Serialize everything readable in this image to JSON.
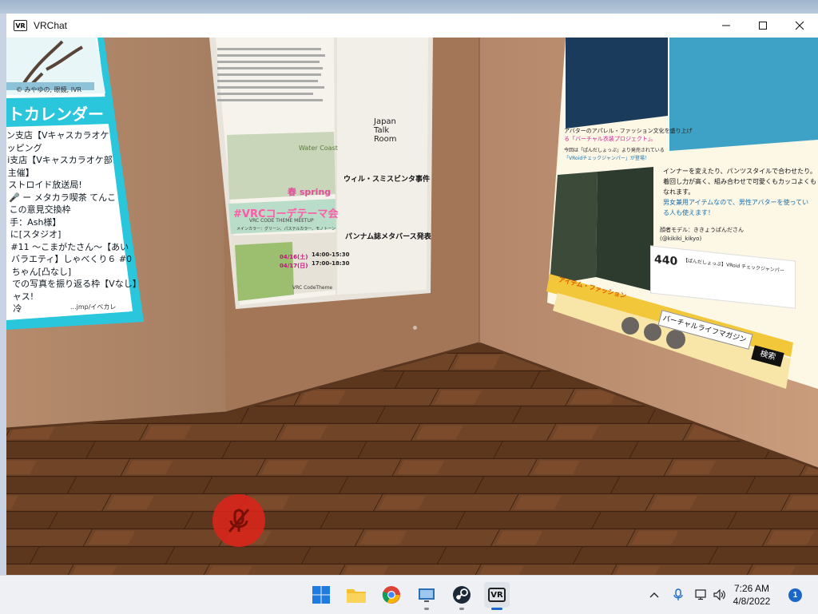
{
  "window": {
    "title": "VRChat",
    "icon_label": "VR",
    "controls": {
      "minimize": "—",
      "maximize": "☐",
      "close": "✕"
    }
  },
  "scene": {
    "calendar_board": {
      "heading": "トカレンダー",
      "credit": "© みやゆの, 眼鏡, IVR",
      "lines": [
        "ン支店【Vキャスカラオケ",
        "ッピング",
        "i支店【Vキャスカラオケ部",
        "主催】",
        "ストロイド放送局!",
        "🎤 ー メタカラ喫茶 てんこ",
        "この意見交換枠",
        "手：Ash様】",
        "に[スタジオ]",
        "#11 〜こまがたさん〜【あい",
        "バラエティ】しゃべくり６ #0",
        "ちゃん[凸なし]",
        "での写真を振り返る枠【Vなし】",
        "ャス!",
        "冷"
      ],
      "url": "...jmp/イベカレ"
    },
    "center_poster": {
      "logo_line1": "Japan",
      "logo_line2": "Talk",
      "logo_line3": "Room",
      "season": "Water Coast",
      "spring": "春 spring",
      "theme_hashtag": "#VRCコーデテーマ会",
      "theme_sub": "VRC CODE THEME MEETUP",
      "theme_desc": "メインカラー：グリーン、パステルカラー、モノトーン",
      "date1": "04/16(土)",
      "time1": "14:00-15:30",
      "date2": "04/17(日)",
      "time2": "17:00-18:30",
      "brand": "VRC CodeTheme",
      "article1_title": "ウィル・スミスビンタ事件",
      "article2_title": "パンナム誌メタバース発表"
    },
    "right_poster": {
      "promo_line1": "アバターのアパレル・ファッション文化を盛り上げ",
      "promo_line2": "る「バーチャル衣装プロジェクト」。",
      "promo_line3": "今回は「ぱんだしょっぷ」より発売されている",
      "promo_line4": "「VRoidチェックジャンパー」が登場！",
      "caption1": "インナーを変えたり、パンツスタイルで合わせたり。",
      "caption2": "着回し力が高く、組み合わせで可愛くもカッコよくも",
      "caption3": "なれます。",
      "caption4": "男女兼用アイテムなので、男性アバターを使ってい",
      "caption5": "る人も使えます！",
      "model_credit": "顔者モデル：ききょうぱんださん",
      "model_handle": "(@kikiki_kikyo)",
      "product_title": "【ぱんだしょっぷ】VRoid チェックジャンパー",
      "price": "440",
      "banner": "アイテム・ファッション",
      "search_value": "バーチャルライフマガジン",
      "search_button": "検索"
    },
    "mic_status": "muted"
  },
  "taskbar": {
    "apps": [
      {
        "name": "windows-start-icon",
        "label": "Start"
      },
      {
        "name": "file-explorer-icon",
        "label": "File Explorer"
      },
      {
        "name": "chrome-icon",
        "label": "Google Chrome"
      },
      {
        "name": "remote-desktop-icon",
        "label": "Remote Desktop"
      },
      {
        "name": "steam-icon",
        "label": "Steam"
      },
      {
        "name": "vrchat-icon",
        "label": "VR"
      }
    ],
    "time": "7:26 AM",
    "date": "4/8/2022",
    "notifications": "1"
  },
  "colors": {
    "wall": "#a37a5c",
    "floor": "#6b4126",
    "calendar_accent": "#29c6dc",
    "poster_yellow": "#f2c83a",
    "mic_red": "#d8261a",
    "accent_blue": "#1a67c9"
  }
}
